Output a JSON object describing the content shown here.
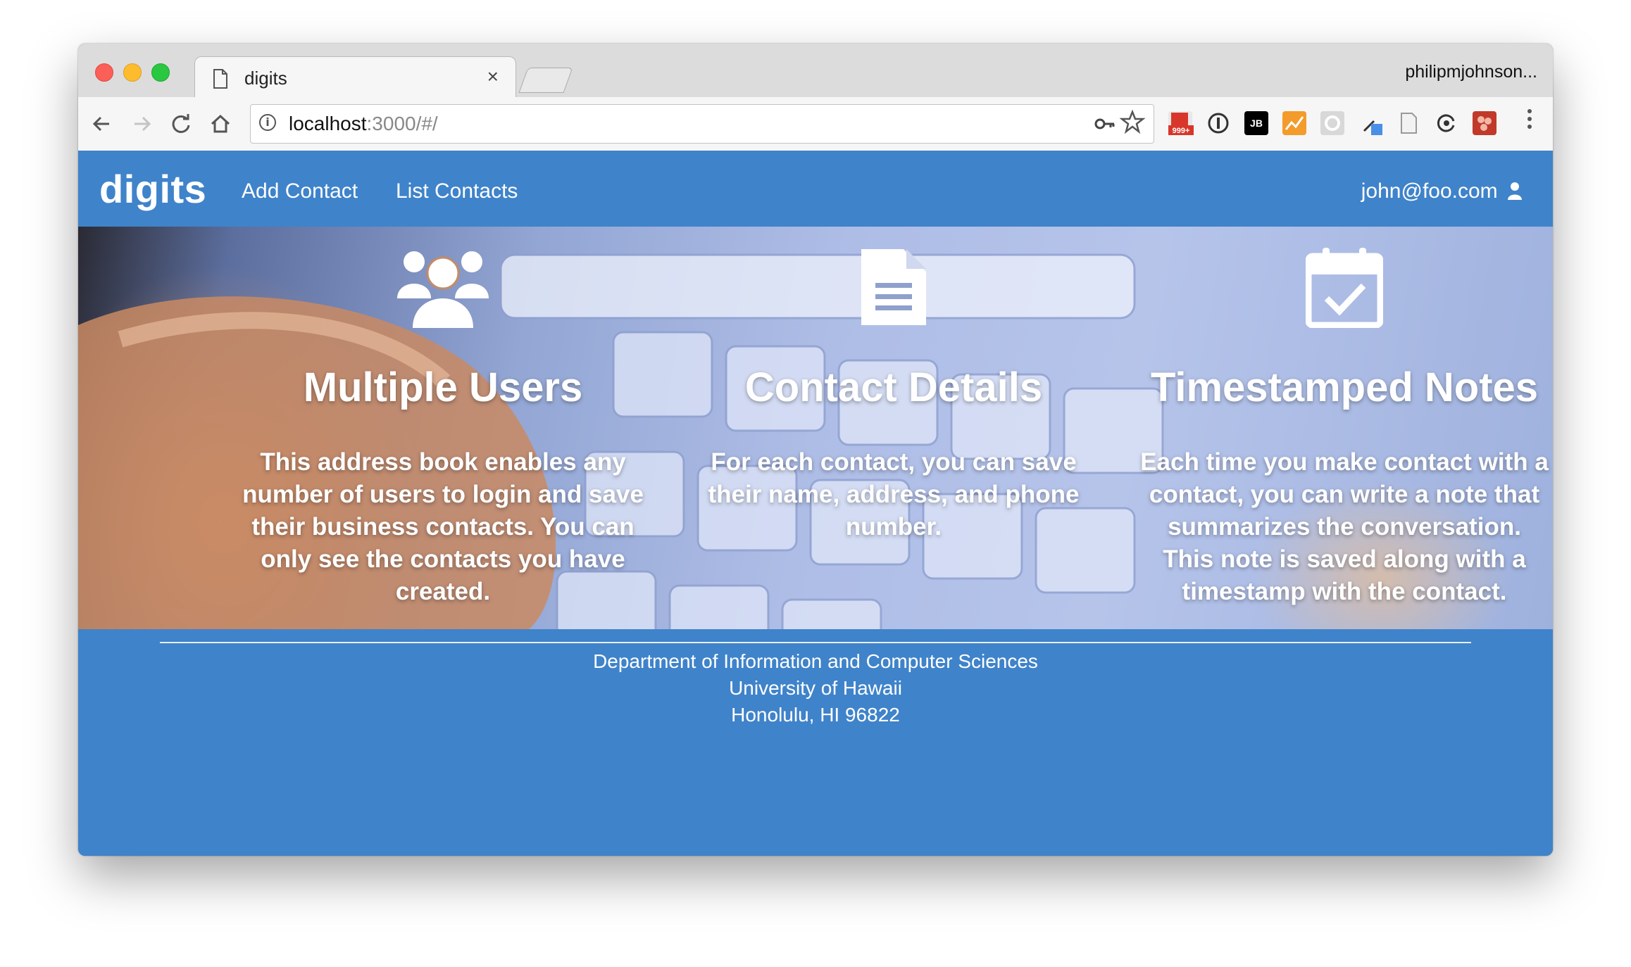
{
  "browser": {
    "tab_title": "digits",
    "tab_close": "×",
    "profile_name": "philipmjohnson...",
    "url_host": "localhost",
    "url_rest": ":3000/#/",
    "extension_badge": "999+",
    "extension_jb": "JB"
  },
  "navbar": {
    "brand": "digits",
    "links": [
      "Add Contact",
      "List Contacts"
    ],
    "user": "john@foo.com"
  },
  "features": [
    {
      "icon": "users-icon",
      "title": "Multiple Users",
      "text": "This address book enables any number of users to login and save their business contacts. You can only see the contacts you have created."
    },
    {
      "icon": "file-text-icon",
      "title": "Contact Details",
      "text": "For each contact, you can save their name, address, and phone number."
    },
    {
      "icon": "calendar-check-icon",
      "title": "Timestamped Notes",
      "text": "Each time you make contact with a contact, you can write a note that summarizes the conversation. This note is saved along with a timestamp with the contact."
    }
  ],
  "footer": {
    "lines": [
      "Department of Information and Computer Sciences",
      "University of Hawaii",
      "Honolulu, HI 96822"
    ]
  },
  "colors": {
    "navbar_bg": "#3f83ca",
    "text": "#ffffff"
  }
}
